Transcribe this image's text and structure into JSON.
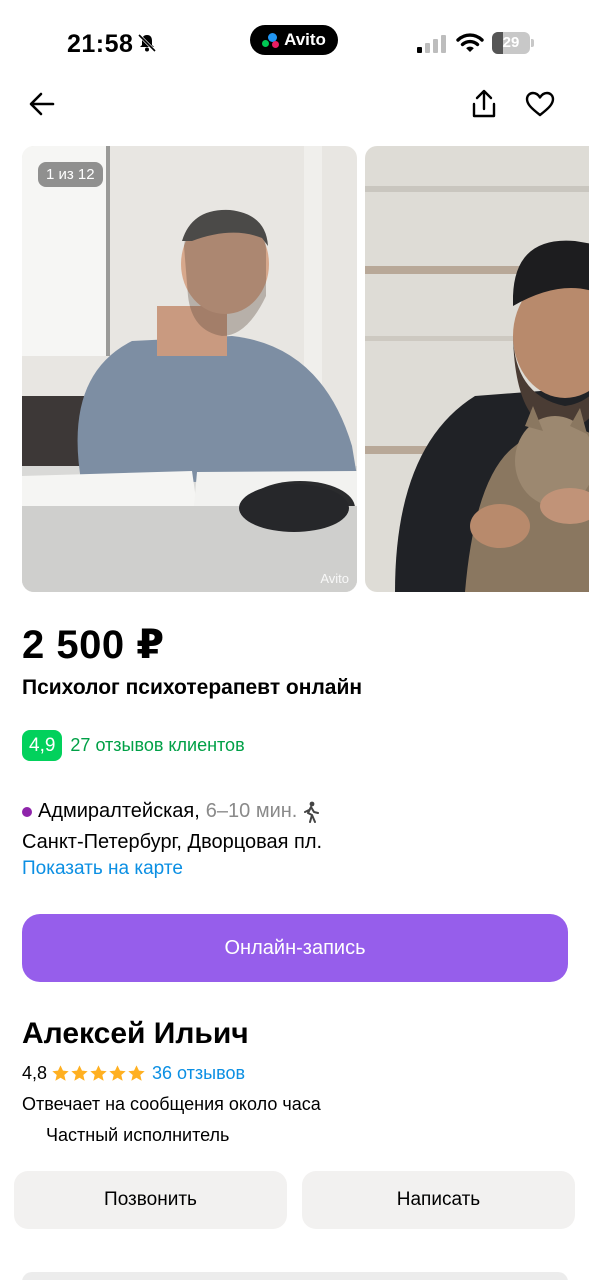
{
  "status_bar": {
    "time": "21:58",
    "app_badge": "Avito",
    "battery_level": "29",
    "battery_fraction": 0.29
  },
  "nav": {
    "back_icon": "arrow-left-icon",
    "share_icon": "share-icon",
    "favorite_icon": "heart-outline-icon"
  },
  "gallery": {
    "counter": "1 из 12",
    "watermark": "Avito"
  },
  "listing": {
    "price": "2 500 ₽",
    "title": "Психолог психотерапевт онлайн",
    "rating": "4,9",
    "reviews": "27 отзывов клиентов"
  },
  "location": {
    "metro_station": "Адмиралтейская,",
    "metro_time": "6–10 мин.",
    "address": "Санкт-Петербург, Дворцовая пл.",
    "map_link": "Показать на карте"
  },
  "booking": {
    "button_label": "Онлайн-запись"
  },
  "seller": {
    "name": "Алексей Ильич",
    "rating": "4,8",
    "stars": 5,
    "reviews": "36 отзывов",
    "reply_time": "Отвечает на сообщения около часа",
    "type": "Частный исполнитель"
  },
  "actions": {
    "call_label": "Позвонить",
    "write_label": "Написать"
  },
  "colors": {
    "accent_purple": "#965eeb",
    "rating_green": "#02d15c",
    "link_green": "#00a046",
    "link_blue": "#0b8fe3",
    "metro_purple": "#8e24aa",
    "star_orange": "#ffb021"
  }
}
